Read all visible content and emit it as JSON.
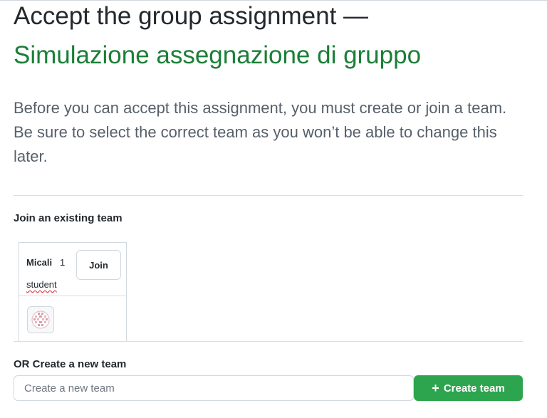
{
  "header": {
    "title_prefix": "Accept the group assignment —",
    "assignment_name": "Simulazione assegnazione di gruppo"
  },
  "description": "Before you can accept this assignment, you must create or join a team. Be sure to select the correct team as you won’t be able to change this later.",
  "join_section": {
    "label": "Join an existing team",
    "teams": [
      {
        "name": "Micali",
        "count": "1",
        "unit": "student",
        "join_label": "Join",
        "avatar_icon": "identicon-avatar"
      }
    ]
  },
  "create_section": {
    "label": "OR Create a new team",
    "input_placeholder": "Create a new team",
    "input_value": "",
    "button_label": "Create team",
    "button_icon": "plus-icon"
  },
  "colors": {
    "accent_green": "#1a7f37",
    "button_green": "#2da44e",
    "spellcheck_red": "#cf222e"
  }
}
